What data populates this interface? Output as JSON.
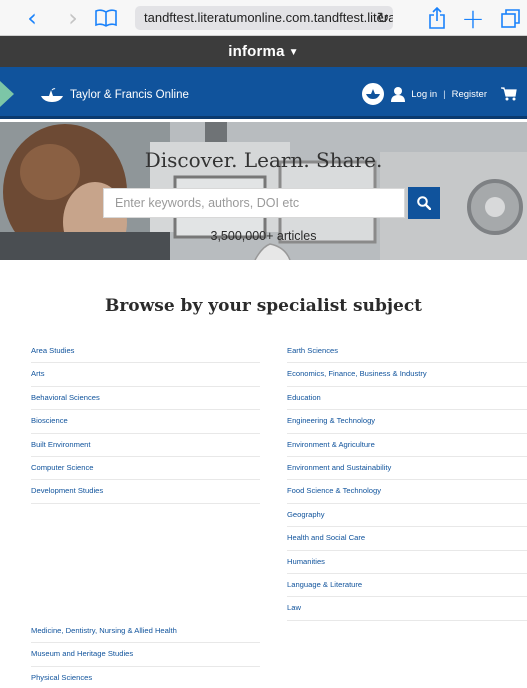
{
  "browser": {
    "url": "tandftest.literatumonline.com.tandftest.literatum"
  },
  "informa": {
    "label": "informa"
  },
  "header": {
    "logo_text": "Taylor & Francis Online",
    "login_label": "Log in",
    "separator": "|",
    "register_label": "Register"
  },
  "hero": {
    "title": "Discover. Learn. Share.",
    "search_placeholder": "Enter keywords, authors, DOI etc",
    "article_count": "3,500,000+ articles"
  },
  "browse": {
    "title": "Browse by your specialist subject",
    "left_subjects": [
      "Area Studies",
      "Arts",
      "Behavioral Sciences",
      "Bioscience",
      "Built Environment",
      "Computer Science",
      "Development Studies"
    ],
    "right_subjects": [
      "Earth Sciences",
      "Economics, Finance, Business & Industry",
      "Education",
      "Engineering & Technology",
      "Environment & Agriculture",
      "Environment and Sustainability",
      "Food Science & Technology",
      "Geography",
      "Health and Social Care",
      "Humanities",
      "Language & Literature",
      "Law"
    ],
    "left_subjects_2": [
      "Medicine, Dentistry, Nursing & Allied Health",
      "Museum and Heritage Studies",
      "Physical Sciences"
    ]
  },
  "colors": {
    "brand_blue": "#10539c",
    "informa_bar": "#3c3c3c",
    "ios_blue": "#1a82fb"
  },
  "icons": [
    "back-icon",
    "forward-icon",
    "bookmarks-icon",
    "reload-icon",
    "share-icon",
    "new-tab-icon",
    "tabs-icon",
    "user-icon",
    "cart-icon",
    "search-icon"
  ]
}
